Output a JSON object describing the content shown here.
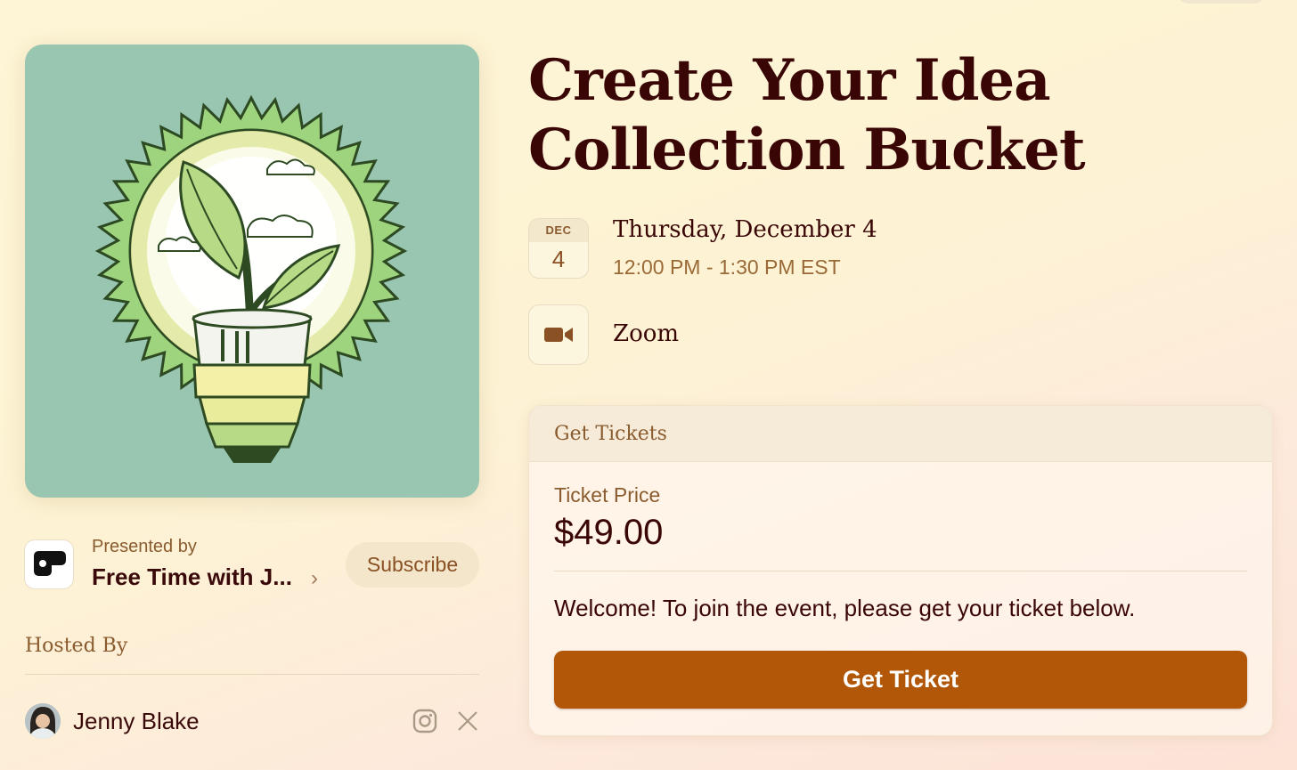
{
  "event": {
    "title_line1": "Create Your Idea",
    "title_line2": "Collection Bucket",
    "date": {
      "month": "DEC",
      "day": "4",
      "full": "Thursday, December 4",
      "time": "12:00 PM - 1:30 PM EST"
    },
    "location": "Zoom"
  },
  "presenter": {
    "label": "Presented by",
    "name": "Free Time with J...",
    "subscribe_label": "Subscribe"
  },
  "hosts": {
    "heading": "Hosted By",
    "items": [
      {
        "name": "Jenny Blake"
      }
    ]
  },
  "tickets": {
    "heading": "Get Tickets",
    "price_label": "Ticket Price",
    "price": "$49.00",
    "message": "Welcome! To join the event, please get your ticket below.",
    "button_label": "Get Ticket"
  },
  "colors": {
    "accent": "#b25707",
    "title": "#3a0505",
    "muted": "#8a5b2e",
    "cover_bg": "#98c6b1"
  },
  "icons": [
    "lightbulb-plant-illustration",
    "video-camera-icon",
    "instagram-icon",
    "x-icon",
    "chevron-right-icon"
  ]
}
